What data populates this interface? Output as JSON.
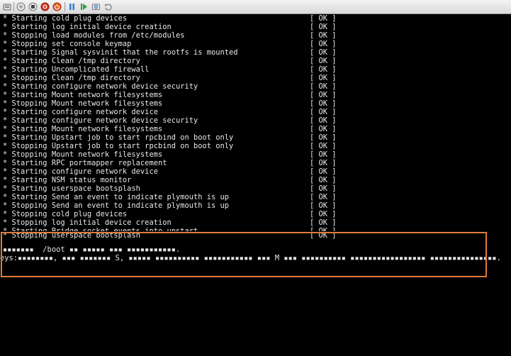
{
  "toolbar": {
    "buttons": [
      {
        "name": "ctrl-alt-del-icon"
      },
      {
        "name": "pause-screen-icon"
      },
      {
        "name": "stop-icon"
      },
      {
        "name": "reset-icon"
      },
      {
        "name": "power-icon"
      },
      {
        "name": "pause-icon"
      },
      {
        "name": "play-icon"
      },
      {
        "name": "snapshot-icon"
      },
      {
        "name": "revert-icon"
      }
    ]
  },
  "console": {
    "lines": [
      {
        "text": "* Starting cold plug devices",
        "status": "[ OK ]"
      },
      {
        "text": "* Starting log initial device creation",
        "status": "[ OK ]"
      },
      {
        "text": "* Stopping load modules from /etc/modules",
        "status": "[ OK ]"
      },
      {
        "text": "* Stopping set console keymap",
        "status": "[ OK ]"
      },
      {
        "text": "* Starting Signal sysvinit that the rootfs is mounted",
        "status": "[ OK ]"
      },
      {
        "text": "* Starting Clean /tmp directory",
        "status": "[ OK ]"
      },
      {
        "text": "* Starting Uncomplicated firewall",
        "status": "[ OK ]"
      },
      {
        "text": "* Stopping Clean /tmp directory",
        "status": "[ OK ]"
      },
      {
        "text": "* Starting configure network device security",
        "status": "[ OK ]"
      },
      {
        "text": "* Starting Mount network filesystems",
        "status": "[ OK ]"
      },
      {
        "text": "* Stopping Mount network filesystems",
        "status": "[ OK ]"
      },
      {
        "text": "* Starting configure network device",
        "status": "[ OK ]"
      },
      {
        "text": "* Starting configure network device security",
        "status": "[ OK ]"
      },
      {
        "text": "* Starting Mount network filesystems",
        "status": "[ OK ]"
      },
      {
        "text": "* Starting Upstart job to start rpcbind on boot only",
        "status": "[ OK ]"
      },
      {
        "text": "* Stopping Upstart job to start rpcbind on boot only",
        "status": "[ OK ]"
      },
      {
        "text": "* Stopping Mount network filesystems",
        "status": "[ OK ]"
      },
      {
        "text": "* Starting RPC portmapper replacement",
        "status": "[ OK ]"
      },
      {
        "text": "* Starting configure network device",
        "status": "[ OK ]"
      },
      {
        "text": "* Starting NSM status monitor",
        "status": "[ OK ]"
      },
      {
        "text": "* Starting userspace bootsplash",
        "status": "[ OK ]"
      },
      {
        "text": "* Starting Send an event to indicate plymouth is up",
        "status": "[ OK ]"
      },
      {
        "text": "* Stopping Send an event to indicate plymouth is up",
        "status": "[ OK ]"
      },
      {
        "text": "* Stopping cold plug devices",
        "status": "[ OK ]"
      },
      {
        "text": "* Stopping log initial device creation",
        "status": "[ OK ]"
      },
      {
        "text": "* Starting Bridge socket events into upstart",
        "status": "[ OK ]"
      },
      {
        "text": "* Stopping userspace bootsplash",
        "status": "[ OK ]"
      }
    ],
    "garbled_line_1": "▪▪▪▪▪▪▪  /boot ▪▪ ▪▪▪▪▪ ▪▪▪ ▪▪▪▪▪▪▪▪▪▪▪.",
    "garbled_line_2": "eys:▪▪▪▪▪▪▪▪, ▪▪▪ ▪▪▪▪▪▪▪ S, ▪▪▪▪▪ ▪▪▪▪▪▪▪▪▪▪ ▪▪▪▪▪▪▪▪▪▪▪ ▪▪▪ M ▪▪▪ ▪▪▪▪▪▪▪▪▪▪ ▪▪▪▪▪▪▪▪▪▪▪▪▪▪▪▪▪ ▪▪▪▪▪▪▪▪▪▪▪▪▪▪▪."
  },
  "colors": {
    "highlight_border": "#e07b39",
    "console_text": "#e8e8e8",
    "console_bg": "#000000"
  }
}
